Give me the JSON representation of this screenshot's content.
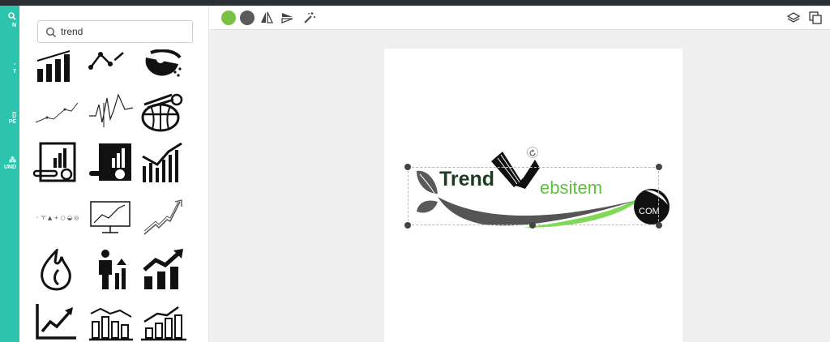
{
  "rail": {
    "items": [
      {
        "name": "rail-item-design",
        "label": "N",
        "icon": "search-icon"
      },
      {
        "name": "rail-item-text",
        "label": "T",
        "icon": "text-icon"
      },
      {
        "name": "rail-item-shape",
        "label": "PE",
        "icon": "shape-icon"
      },
      {
        "name": "rail-item-background",
        "label": "UND",
        "icon": "background-icon"
      }
    ]
  },
  "panel": {
    "search": {
      "value": "trend",
      "icon": "search-icon"
    },
    "icons": [
      "bar-chart-icon",
      "line-chart-icon",
      "globe-dots-icon",
      "trend-line-thin-icon",
      "heartbeat-line-icon",
      "globe-chart-icon",
      "report-clipboard-icon",
      "report-clipboard-filled-icon",
      "rising-bars-icon",
      "small-symbols-icon",
      "monitor-chart-icon",
      "arrow-zigzag-icon",
      "flame-icon",
      "person-growth-icon",
      "growth-bars-arrow-icon",
      "line-chart-arrow-icon",
      "bars-line-icon",
      "bars-arrow-icon"
    ]
  },
  "toolbar": {
    "colors": [
      "#7ac143",
      "#5a5a5a"
    ],
    "tools": [
      "flip-horizontal-icon",
      "flip-vertical-icon",
      "magic-wand-icon"
    ],
    "right_tools": [
      "layers-icon",
      "duplicate-icon"
    ]
  },
  "logo": {
    "word1": "Trend",
    "word2": "ebsitem",
    "suffix": "COM",
    "colors": {
      "dark": "#1e3b20",
      "green": "#7ed957",
      "gray": "#555555"
    },
    "icons": [
      "leaf-icon",
      "rotate-icon"
    ]
  }
}
